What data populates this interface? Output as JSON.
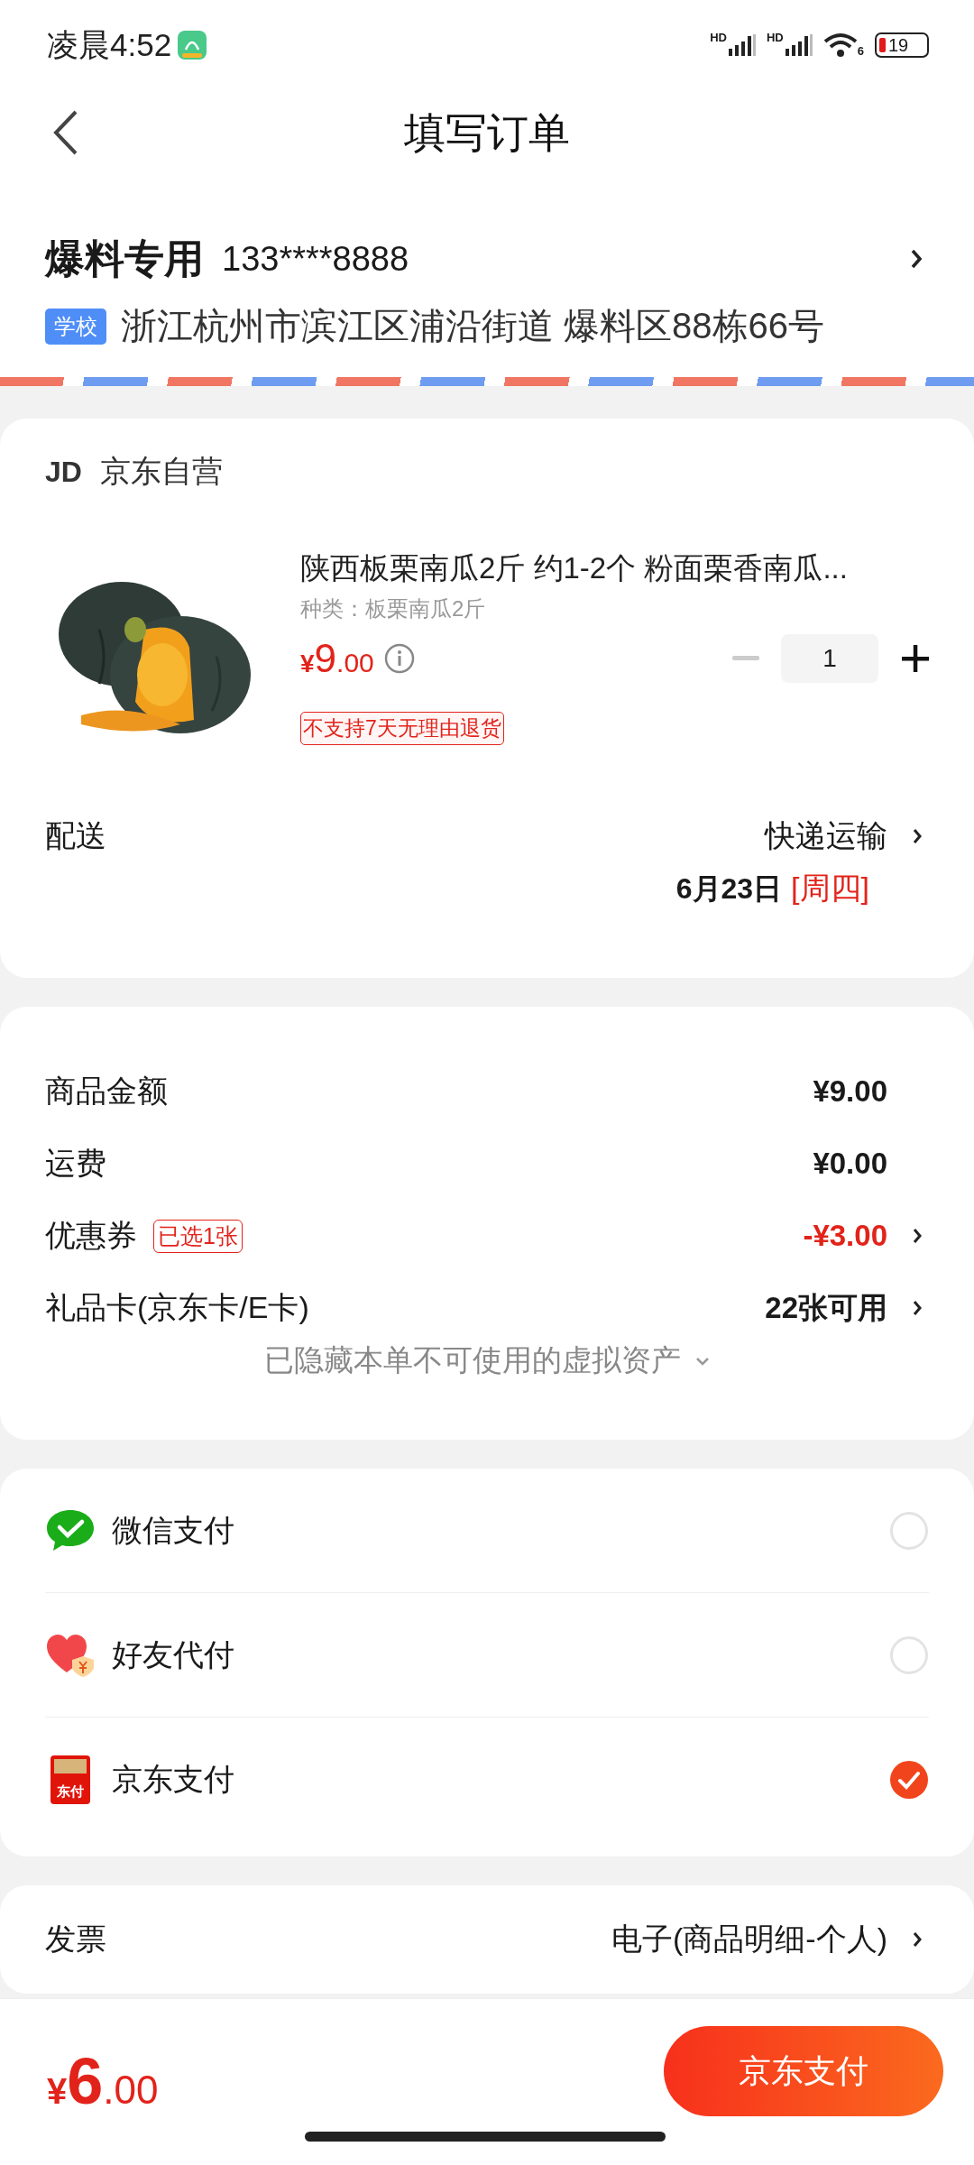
{
  "status_bar": {
    "time": "凌晨4:52",
    "signal_labels": [
      "HD",
      "HD"
    ],
    "wifi_label": "6",
    "battery": "19"
  },
  "header": {
    "title": "填写订单"
  },
  "address": {
    "name": "爆料专用",
    "phone": "133****8888",
    "tag": "学校",
    "detail": "浙江杭州市滨江区浦沿街道 爆料区88栋66号"
  },
  "shop": {
    "logo": "JD",
    "name": "京东自营"
  },
  "product": {
    "title": "陕西板栗南瓜2斤 约1-2个 粉面栗香南瓜...",
    "spec": "种类：板栗南瓜2斤",
    "price": {
      "symbol": "¥",
      "integer": "9",
      "decimal": ".00"
    },
    "quantity": "1",
    "minus_disabled": true,
    "notice": "不支持7天无理由退货"
  },
  "delivery": {
    "label": "配送",
    "method": "快递运输",
    "date": "6月23日",
    "weekday": "[周四]"
  },
  "costs": [
    {
      "label": "商品金额",
      "value": "¥9.00",
      "kind": "plain"
    },
    {
      "label": "运费",
      "value": "¥0.00",
      "kind": "plain"
    },
    {
      "label": "优惠券",
      "tag": "已选1张",
      "value": "-¥3.00",
      "kind": "discount"
    },
    {
      "label": "礼品卡(京东卡/E卡)",
      "value": "22张可用",
      "kind": "link"
    }
  ],
  "hidden_note": "已隐藏本单不可使用的虚拟资产",
  "payments": [
    {
      "kind": "wechat",
      "label": "微信支付",
      "selected": false
    },
    {
      "kind": "friend",
      "label": "好友代付",
      "selected": false
    },
    {
      "kind": "jdpay",
      "label": "京东支付",
      "icon_text": "东付",
      "selected": true
    }
  ],
  "invoice": {
    "label": "发票",
    "value": "电子(商品明细-个人)"
  },
  "footer": {
    "total": {
      "symbol": "¥",
      "integer": "6",
      "decimal": ".00"
    },
    "button": "京东支付"
  }
}
